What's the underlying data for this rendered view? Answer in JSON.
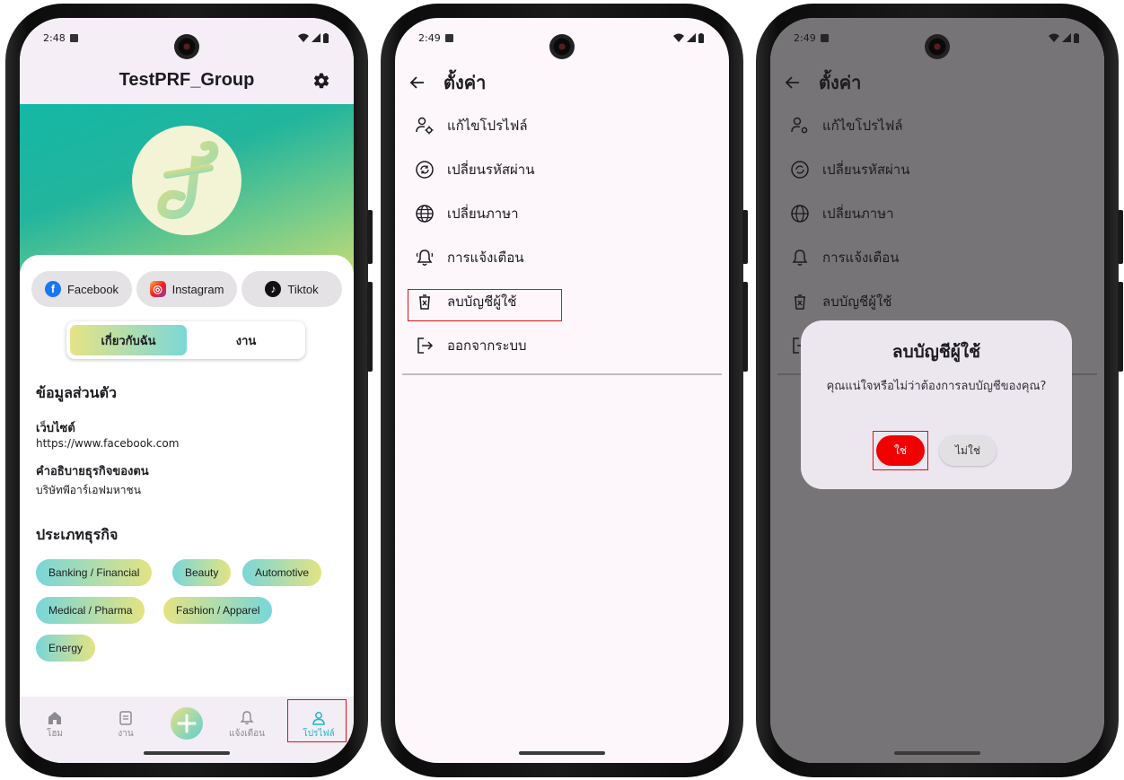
{
  "colors": {
    "accent": "#1bb8c4",
    "danger": "#f00000",
    "highlight_box": "#d81414"
  },
  "phone1": {
    "time": "2:48",
    "title": "TestPRF_Group",
    "social": [
      "Facebook",
      "Instagram",
      "Tiktok"
    ],
    "tabs": {
      "active": "เกี่ยวกับฉัน",
      "other": "งาน"
    },
    "section_personal": "ข้อมูลส่วนตัว",
    "website_label": "เว็บไซต์",
    "website_value": "https://www.facebook.com",
    "desc_label": "คำอธิบายธุรกิจของตน",
    "desc_value": "บริษัทพีอาร์เอฟมหาชน",
    "section_business": "ประเภทธุรกิจ",
    "categories": [
      "Banking / Financial",
      "Beauty",
      "Automotive",
      "Medical / Pharma",
      "Fashion / Apparel",
      "Energy"
    ],
    "nav": {
      "home": "โฮม",
      "jobs": "งาน",
      "notifications": "แจ้งเตือน",
      "profile": "โปรไฟล์",
      "active": "profile"
    }
  },
  "settings": {
    "time": "2:49",
    "title": "ตั้งค่า",
    "items": [
      "แก้ไขโปรไฟล์",
      "เปลี่ยนรหัสผ่าน",
      "เปลี่ยนภาษา",
      "การแจ้งเตือน",
      "ลบบัญชีผู้ใช้",
      "ออกจากระบบ"
    ],
    "icons": [
      "edit-profile-icon",
      "change-password-icon",
      "globe-icon",
      "bell-icon",
      "delete-icon",
      "logout-icon"
    ],
    "highlighted_item": "ลบบัญชีผู้ใช้"
  },
  "dialog": {
    "title": "ลบบัญชีผู้ใช้",
    "message": "คุณแน่ใจหรือไม่ว่าต้องการลบบัญชีของคุณ?",
    "confirm": "ใช่",
    "cancel": "ไม่ใช่"
  }
}
